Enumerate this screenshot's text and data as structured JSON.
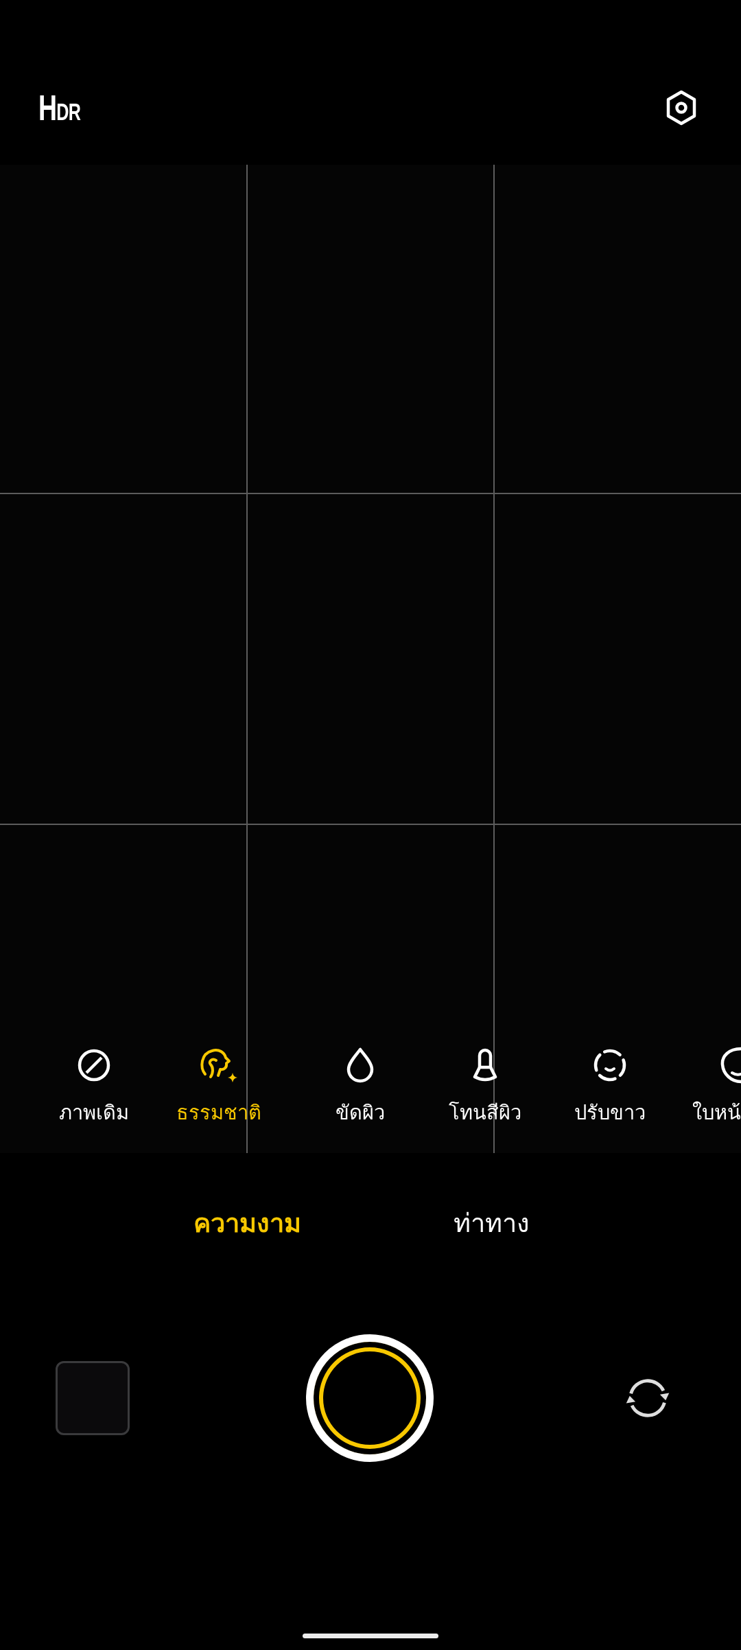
{
  "top_bar": {
    "hdr_label": "HDR"
  },
  "beauty_options": [
    {
      "kind": "off",
      "label": "ภาพเดิม",
      "selected": false
    },
    {
      "kind": "natural",
      "label": "ธรรมชาติ",
      "selected": true
    },
    {
      "kind": "smooth",
      "label": "ขัดผิว",
      "selected": false
    },
    {
      "kind": "tone",
      "label": "โทนสีผิว",
      "selected": false
    },
    {
      "kind": "whiten",
      "label": "ปรับขาว",
      "selected": false
    },
    {
      "kind": "face",
      "label": "ใบหน้",
      "selected": false
    }
  ],
  "mode_tabs": [
    {
      "label": "ความงาม",
      "selected": true
    },
    {
      "label": "ท่าทาง",
      "selected": false
    }
  ]
}
